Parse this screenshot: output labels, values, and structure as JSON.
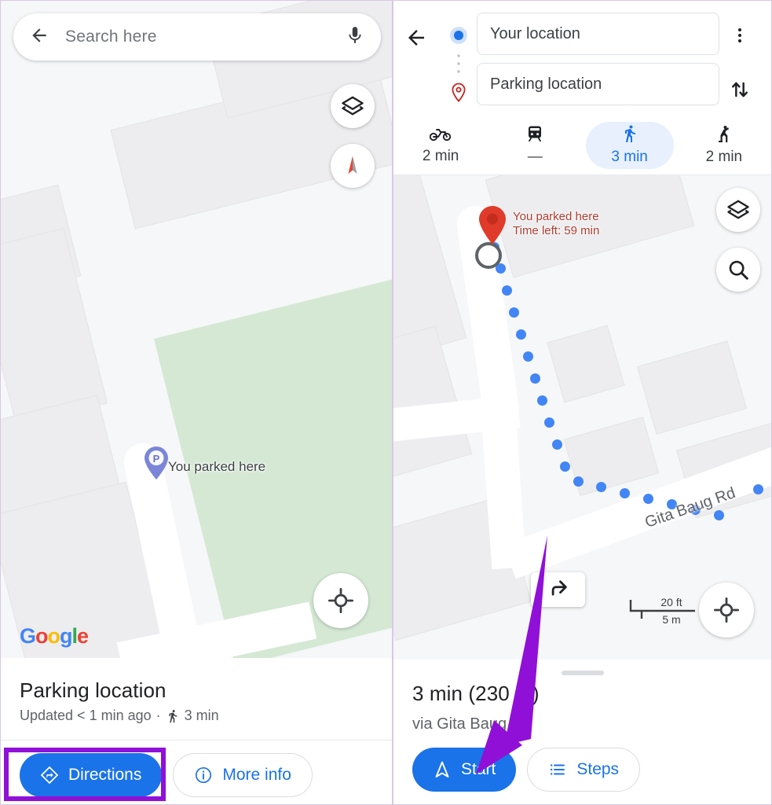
{
  "left_screen": {
    "search": {
      "placeholder": "Search here",
      "back_icon": "back-arrow-icon",
      "mic_icon": "microphone-icon"
    },
    "map_controls": {
      "layers": "layers-icon",
      "compass": "compass-icon",
      "locate": "my-location-icon"
    },
    "map": {
      "parking_pin_letter": "P",
      "parking_label": "You parked here",
      "attribution": "Google"
    },
    "sheet": {
      "title": "Parking location",
      "subtitle_prefix": "Updated < 1 min ago",
      "separator": "·",
      "walk_icon": "walking-person-icon",
      "walk_time": "3 min",
      "directions_label": "Directions",
      "directions_icon": "directions-diamond-icon",
      "more_info_label": "More info",
      "more_info_icon": "info-circle-icon"
    },
    "annotation": {
      "highlight_color": "#9010d8"
    }
  },
  "right_screen": {
    "header": {
      "back_icon": "back-arrow-icon",
      "overflow_icon": "more-vert-icon",
      "swap_icon": "swap-vertical-icon",
      "origin_dot_icon": "origin-dot-icon",
      "destination_pin_icon": "destination-pin-icon",
      "origin_value": "Your location",
      "destination_value": "Parking location"
    },
    "modes": [
      {
        "icon": "motorcycle-icon",
        "time": "2 min",
        "active": false
      },
      {
        "icon": "transit-train-icon",
        "time": "—",
        "active": false
      },
      {
        "icon": "walking-person-icon",
        "time": "3 min",
        "active": true
      },
      {
        "icon": "ride-hailing-icon",
        "time": "2 min",
        "active": false
      }
    ],
    "map": {
      "parked_label_line1": "You parked here",
      "parked_label_line2": "Time left: 59 min",
      "street_name": "Gita Baug Rd",
      "turn_icon": "turn-right-icon",
      "scale_imperial": "20 ft",
      "scale_metric": "5 m",
      "layers_icon": "layers-icon",
      "search_icon": "search-icon",
      "locate_icon": "my-location-icon",
      "route_color": "#4285f4",
      "pin_color": "#e03b2a"
    },
    "sheet": {
      "eta": "3 min (230 m)",
      "via": "via Gita Baug Rd",
      "start_label": "Start",
      "start_icon": "navigation-arrow-icon",
      "steps_label": "Steps",
      "steps_icon": "list-icon"
    },
    "annotation": {
      "arrow_color": "#9010d8"
    }
  }
}
